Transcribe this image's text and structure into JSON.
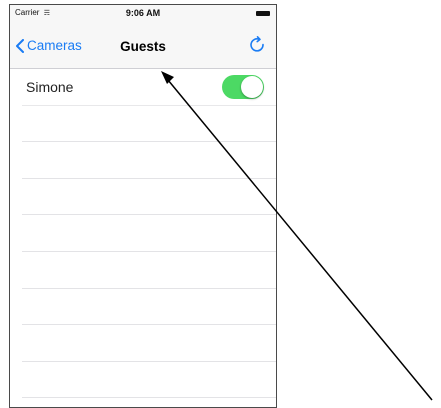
{
  "status_bar": {
    "carrier": "Carrier",
    "time": "9:06 AM",
    "wifi_icon": "wifi-icon",
    "battery_icon": "battery-icon"
  },
  "nav_bar": {
    "back_label": "Cameras",
    "title": "Guests",
    "back_icon": "chevron-left-icon",
    "refresh_icon": "refresh-icon",
    "accent_color": "#1a7cf4"
  },
  "list": {
    "rows": [
      {
        "label": "Simone",
        "toggle_on": true
      },
      {
        "label": ""
      },
      {
        "label": ""
      },
      {
        "label": ""
      },
      {
        "label": ""
      },
      {
        "label": ""
      },
      {
        "label": ""
      },
      {
        "label": ""
      },
      {
        "label": ""
      }
    ],
    "toggle_on_color": "#4cd964"
  },
  "annotation": {
    "type": "arrow",
    "color": "#000000"
  }
}
